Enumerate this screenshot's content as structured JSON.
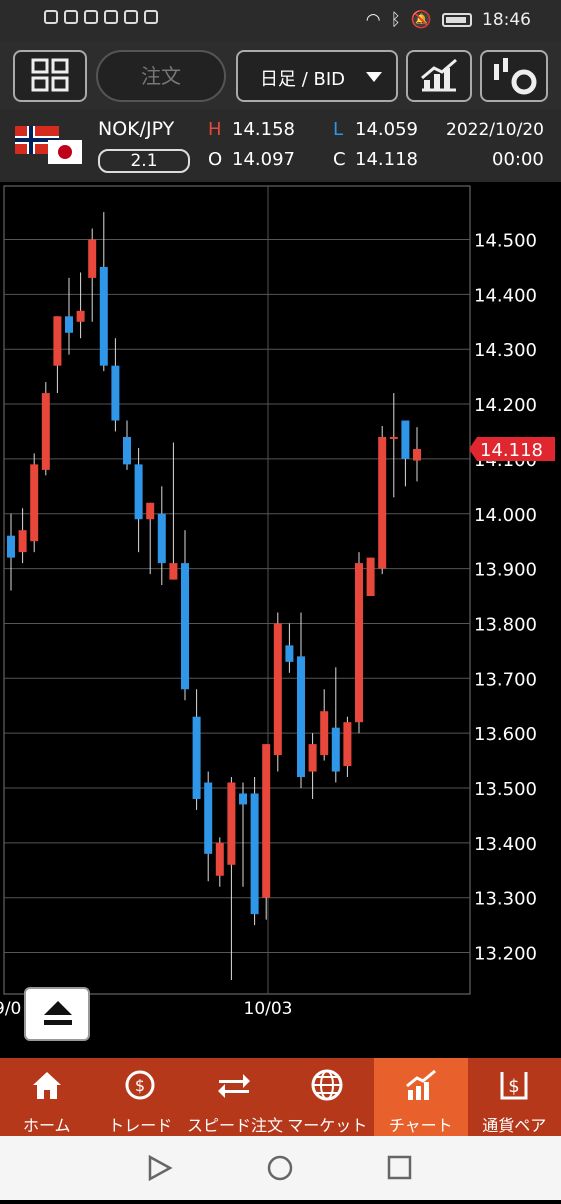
{
  "status_bar": {
    "time": "18:46"
  },
  "toolbar": {
    "order_label": "注文",
    "period_label": "日足 / BID"
  },
  "quote": {
    "pair": "NOK/JPY",
    "spread": "2.1",
    "high_label": "H",
    "high": "14.158",
    "low_label": "L",
    "low": "14.059",
    "open_label": "O",
    "open": "14.097",
    "close_label": "C",
    "close": "14.118",
    "date": "2022/10/20",
    "time": "00:00"
  },
  "colors": {
    "up": "#e8473c",
    "down": "#2f96e8",
    "current_price_tag": "#e0262f",
    "tab_bar": "#b5381b",
    "tab_active": "#e8612c"
  },
  "chart_data": {
    "type": "candlestick",
    "y_ticks": [
      "14.500",
      "14.400",
      "14.300",
      "14.200",
      "14.100",
      "14.000",
      "13.900",
      "13.800",
      "13.700",
      "13.600",
      "13.500",
      "13.400",
      "13.300",
      "13.200"
    ],
    "x_tick_labels": [
      "9/0",
      "10/03"
    ],
    "current_price": "14.118",
    "candles": [
      {
        "o": 13.96,
        "h": 14.0,
        "l": 13.86,
        "c": 13.92
      },
      {
        "o": 13.93,
        "h": 14.01,
        "l": 13.91,
        "c": 13.97
      },
      {
        "o": 13.95,
        "h": 14.11,
        "l": 13.93,
        "c": 14.09
      },
      {
        "o": 14.08,
        "h": 14.24,
        "l": 14.07,
        "c": 14.22
      },
      {
        "o": 14.27,
        "h": 14.32,
        "l": 14.22,
        "c": 14.36
      },
      {
        "o": 14.36,
        "h": 14.43,
        "l": 14.29,
        "c": 14.33
      },
      {
        "o": 14.35,
        "h": 14.44,
        "l": 14.32,
        "c": 14.37
      },
      {
        "o": 14.43,
        "h": 14.52,
        "l": 14.35,
        "c": 14.5
      },
      {
        "o": 14.45,
        "h": 14.55,
        "l": 14.26,
        "c": 14.27
      },
      {
        "o": 14.27,
        "h": 14.32,
        "l": 14.15,
        "c": 14.17
      },
      {
        "o": 14.14,
        "h": 14.17,
        "l": 14.08,
        "c": 14.09
      },
      {
        "o": 14.09,
        "h": 14.12,
        "l": 13.93,
        "c": 13.99
      },
      {
        "o": 13.99,
        "h": 14.02,
        "l": 13.89,
        "c": 14.02
      },
      {
        "o": 14.0,
        "h": 14.05,
        "l": 13.87,
        "c": 13.91
      },
      {
        "o": 13.88,
        "h": 14.13,
        "l": 13.89,
        "c": 13.91
      },
      {
        "o": 13.91,
        "h": 13.97,
        "l": 13.66,
        "c": 13.68
      },
      {
        "o": 13.63,
        "h": 13.68,
        "l": 13.46,
        "c": 13.48
      },
      {
        "o": 13.51,
        "h": 13.53,
        "l": 13.33,
        "c": 13.38
      },
      {
        "o": 13.34,
        "h": 13.41,
        "l": 13.32,
        "c": 13.4
      },
      {
        "o": 13.36,
        "h": 13.52,
        "l": 13.15,
        "c": 13.51
      },
      {
        "o": 13.49,
        "h": 13.51,
        "l": 13.32,
        "c": 13.47
      },
      {
        "o": 13.49,
        "h": 13.52,
        "l": 13.25,
        "c": 13.27
      },
      {
        "o": 13.3,
        "h": 13.57,
        "l": 13.26,
        "c": 13.58
      },
      {
        "o": 13.56,
        "h": 13.82,
        "l": 13.53,
        "c": 13.8
      },
      {
        "o": 13.76,
        "h": 13.8,
        "l": 13.71,
        "c": 13.73
      },
      {
        "o": 13.74,
        "h": 13.82,
        "l": 13.5,
        "c": 13.52
      },
      {
        "o": 13.53,
        "h": 13.6,
        "l": 13.48,
        "c": 13.58
      },
      {
        "o": 13.56,
        "h": 13.68,
        "l": 13.55,
        "c": 13.64
      },
      {
        "o": 13.61,
        "h": 13.72,
        "l": 13.51,
        "c": 13.53
      },
      {
        "o": 13.54,
        "h": 13.63,
        "l": 13.52,
        "c": 13.62
      },
      {
        "o": 13.62,
        "h": 13.93,
        "l": 13.6,
        "c": 13.91
      },
      {
        "o": 13.85,
        "h": 13.92,
        "l": 13.85,
        "c": 13.92
      },
      {
        "o": 13.9,
        "h": 14.16,
        "l": 13.89,
        "c": 14.14
      },
      {
        "o": 14.14,
        "h": 14.22,
        "l": 14.03,
        "c": 14.14
      },
      {
        "o": 14.17,
        "h": 14.16,
        "l": 14.05,
        "c": 14.1
      },
      {
        "o": 14.097,
        "h": 14.158,
        "l": 14.059,
        "c": 14.118
      }
    ]
  },
  "tabs": [
    {
      "label": "ホーム",
      "icon": "home-icon"
    },
    {
      "label": "トレード",
      "icon": "trade-icon"
    },
    {
      "label": "スピード注文",
      "icon": "speed-order-icon"
    },
    {
      "label": "マーケット",
      "icon": "globe-icon"
    },
    {
      "label": "チャート",
      "icon": "chart-icon"
    },
    {
      "label": "通貨ペア",
      "icon": "currency-pair-icon"
    }
  ]
}
